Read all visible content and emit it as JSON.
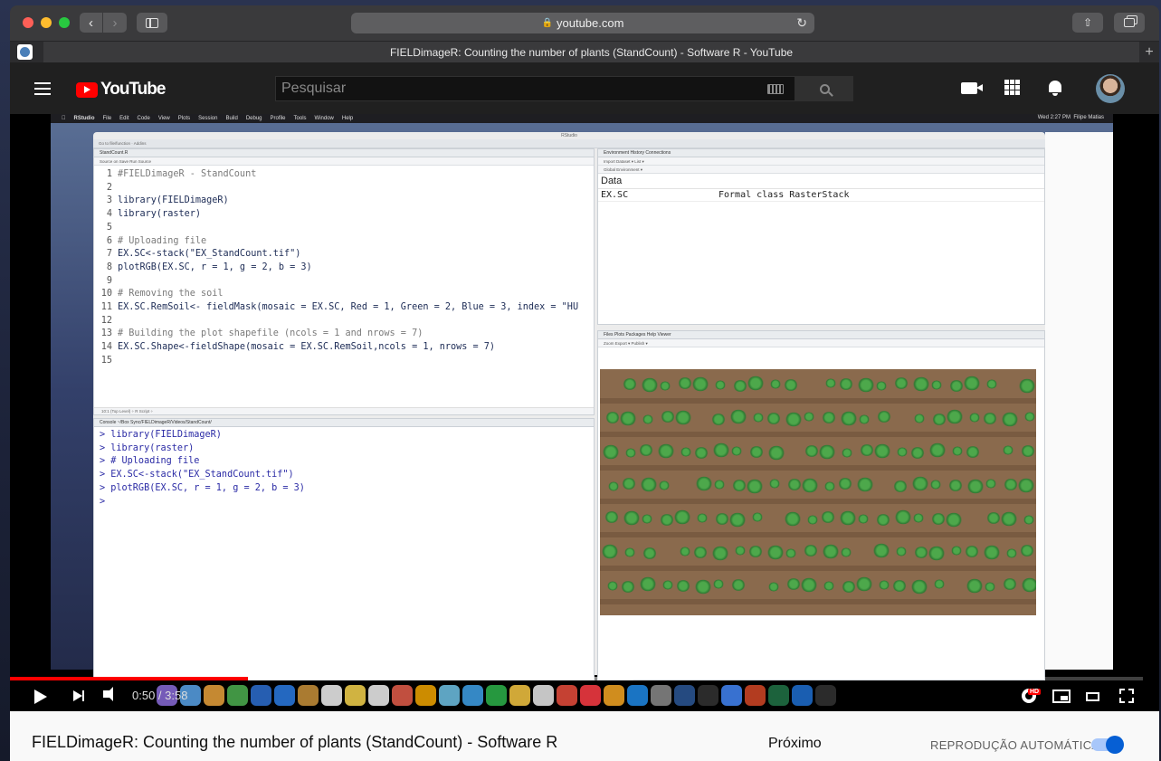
{
  "browser": {
    "url": "youtube.com",
    "tab_title": "FIELDimageR: Counting the number of plants (StandCount) - Software R - YouTube"
  },
  "youtube": {
    "logo_text": "YouTube",
    "search_placeholder": "Pesquisar"
  },
  "video_frame": {
    "menubar": {
      "app": "RStudio",
      "items": [
        "File",
        "Edit",
        "Code",
        "View",
        "Plots",
        "Session",
        "Build",
        "Debug",
        "Profile",
        "Tools",
        "Window",
        "Help"
      ],
      "clock": "Wed 2:27 PM",
      "user": "Filipe Matias"
    },
    "rstudio": {
      "title": "RStudio",
      "toolbar": "Go to file/function   ·   Addins",
      "editor_tab": "StandCount.R",
      "editor_tools": "Source on Save          Run   Source",
      "code_lines": [
        {
          "n": "1",
          "t": "#FIELDimageR - StandCount",
          "k": "cm"
        },
        {
          "n": "2",
          "t": "",
          "k": "fn"
        },
        {
          "n": "3",
          "t": "library(FIELDimageR)",
          "k": "fn"
        },
        {
          "n": "4",
          "t": "library(raster)",
          "k": "fn"
        },
        {
          "n": "5",
          "t": "",
          "k": "fn"
        },
        {
          "n": "6",
          "t": "# Uploading file",
          "k": "cm"
        },
        {
          "n": "7",
          "t": "EX.SC<-stack(\"EX_StandCount.tif\")",
          "k": "fn"
        },
        {
          "n": "8",
          "t": "plotRGB(EX.SC, r = 1, g = 2, b = 3)",
          "k": "fn"
        },
        {
          "n": "9",
          "t": "",
          "k": "fn"
        },
        {
          "n": "10",
          "t": "# Removing the soil",
          "k": "cm"
        },
        {
          "n": "11",
          "t": "EX.SC.RemSoil<- fieldMask(mosaic = EX.SC, Red = 1, Green = 2, Blue = 3, index = \"HU",
          "k": "fn"
        },
        {
          "n": "12",
          "t": "",
          "k": "fn"
        },
        {
          "n": "13",
          "t": "# Building the plot shapefile (ncols = 1 and nrows = 7)",
          "k": "cm"
        },
        {
          "n": "14",
          "t": "EX.SC.Shape<-fieldShape(mosaic = EX.SC.RemSoil,ncols = 1, nrows = 7)",
          "k": "fn"
        },
        {
          "n": "15",
          "t": "",
          "k": "fn"
        }
      ],
      "editor_status": "10:1     (Top Level) ÷                                                                                              R Script ÷",
      "console_tab": "Console   ~/Box Sync/FIELDimageR/Videos/StandCount/",
      "console_lines": [
        "> library(FIELDimageR)",
        "> library(raster)",
        "> # Uploading file",
        "> EX.SC<-stack(\"EX_StandCount.tif\")",
        "> plotRGB(EX.SC, r = 1, g = 2, b = 3)",
        "> "
      ],
      "env_tabs": "Environment   History   Connections",
      "env_tools": "Import Dataset ▾                                                                                List ▾",
      "env_scope": "Global Environment ▾",
      "env_data_heading": "Data",
      "env_row": {
        "name": "EX.SC",
        "value": "Formal class RasterStack"
      },
      "plots_tabs": "Files   Plots   Packages   Help   Viewer",
      "plots_tools": "Zoom   Export ▾                                                                         Publish ▾"
    }
  },
  "player": {
    "time": "0:50 / 3:58",
    "progress": 0.21,
    "buffered": 0.55,
    "hd_badge": "HD"
  },
  "below_video": {
    "title": "FIELDimageR: Counting the number of plants (StandCount) - Software R",
    "next_label": "Próximo",
    "autoplay_label": "REPRODUÇÃO AUTOMÁTICA",
    "autoplay_on": true
  },
  "dock_colors": [
    "#3b7be8",
    "#e8e8e8",
    "#8a6bd8",
    "#58a2e8",
    "#e8a13b",
    "#4caf50",
    "#2d6fd0",
    "#2a7ae2",
    "#c8903a",
    "#f0f0f0",
    "#f5d24c",
    "#f0f0f0",
    "#e35d4a",
    "#f0a400",
    "#6ec1e4",
    "#3ea0e8",
    "#2db34a",
    "#f5c542",
    "#e8e8e8",
    "#e74c3c",
    "#fc3c44",
    "#f5a623",
    "#1e88e5",
    "#8a8a8a",
    "#2b5797",
    "#333333",
    "#4285f4",
    "#d24726",
    "#217346",
    "#1e6fd0",
    "#333333"
  ]
}
